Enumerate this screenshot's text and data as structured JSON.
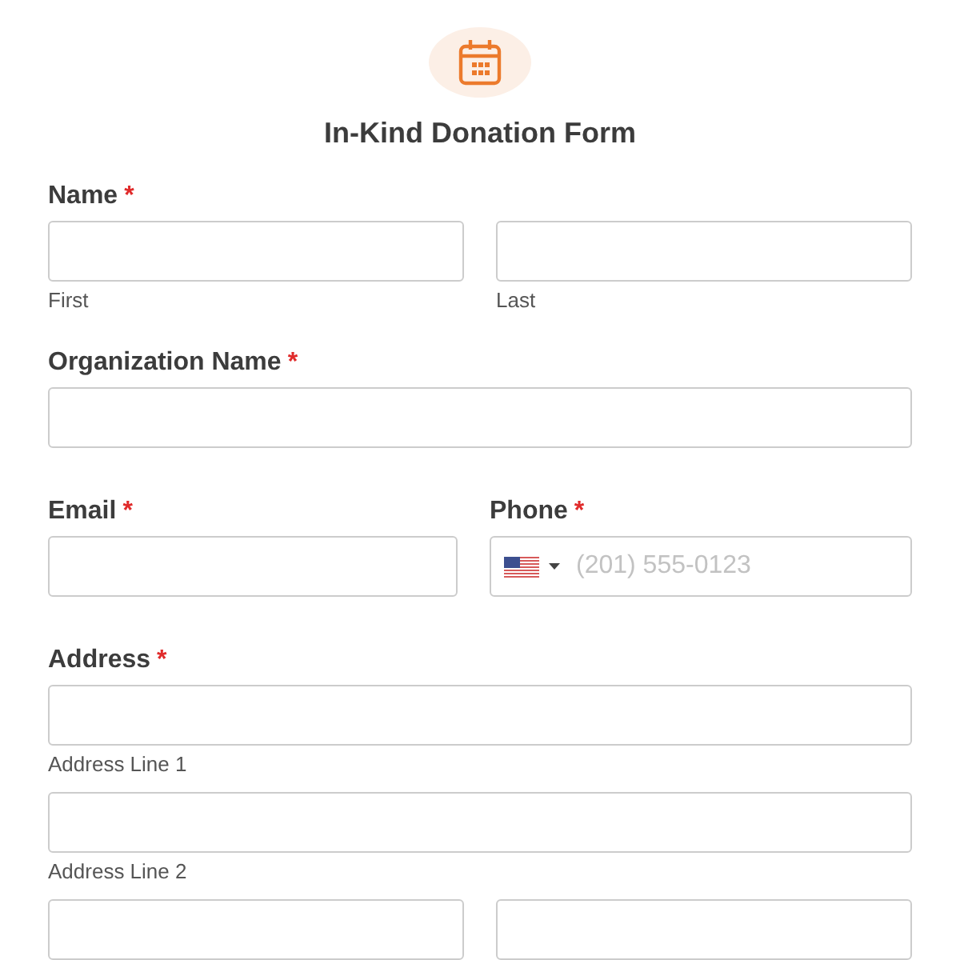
{
  "header": {
    "title": "In-Kind Donation Form"
  },
  "fields": [
    {
      "kind": "split",
      "label": "Name",
      "required_mark": "*",
      "parts": [
        {
          "sublabel": "First"
        },
        {
          "sublabel": "Last"
        }
      ]
    },
    {
      "kind": "single",
      "label": "Organization Name",
      "required_mark": "*"
    },
    {
      "kind": "pair",
      "items": [
        {
          "kind": "text",
          "label": "Email",
          "required_mark": "*"
        },
        {
          "kind": "phone",
          "label": "Phone",
          "required_mark": "*",
          "placeholder": "(201) 555-0123"
        }
      ]
    },
    {
      "kind": "address",
      "label": "Address",
      "required_mark": "*",
      "lines": [
        {
          "sublabel": "Address Line 1"
        },
        {
          "sublabel": "Address Line 2"
        }
      ],
      "row": [
        {
          "kind": "input"
        },
        {
          "kind": "input"
        }
      ]
    }
  ]
}
